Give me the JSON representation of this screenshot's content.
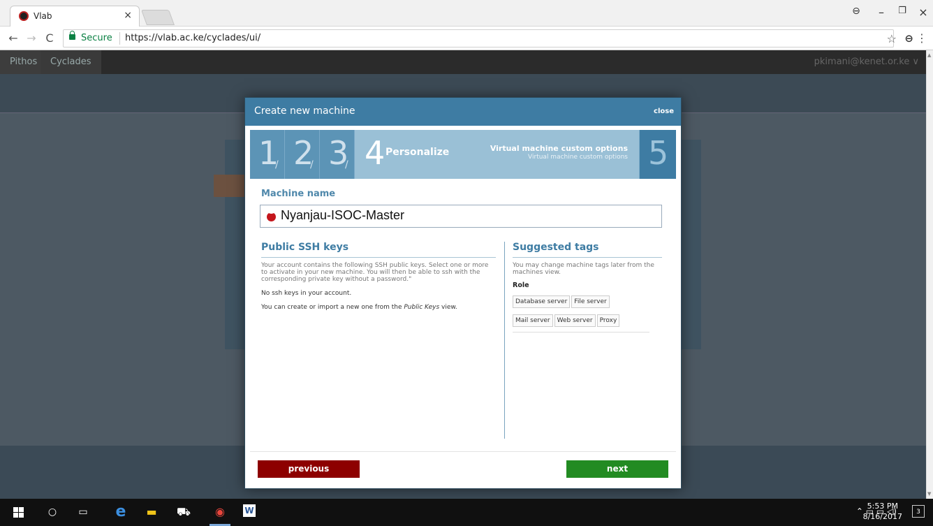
{
  "browser": {
    "tab_title": "Vlab",
    "tab_close": "×",
    "security_label": "Secure",
    "url": "https://vlab.ac.ke/cyclades/ui/",
    "window_controls": [
      "–",
      "❐",
      "×"
    ]
  },
  "topnav": {
    "items": [
      "Pithos",
      "Cyclades"
    ],
    "user": "pkimani@kenet.or.ke ∨"
  },
  "modal": {
    "title": "Create new machine",
    "close_label": "close",
    "steps": [
      {
        "number": "1"
      },
      {
        "number": "2"
      },
      {
        "number": "3"
      },
      {
        "number": "4",
        "label": "Personalize",
        "current": true
      },
      {
        "number": "5"
      }
    ],
    "step_description_main": "Virtual machine custom options",
    "step_description_sub": "Virtual machine custom options",
    "machine_name_label": "Machine name",
    "machine_name_value": "Nyanjau-ISOC-Master",
    "ssh": {
      "title": "Public SSH keys",
      "description": "Your account contains the following SSH public keys. Select one or more to activate in your new machine. You will then be able to ssh with the corresponding private key without a password.\"",
      "no_keys": "No ssh keys in your account.",
      "create_prefix": "You can create or import a new one from the ",
      "create_link": "Public Keys",
      "create_suffix": " view."
    },
    "tags": {
      "title": "Suggested tags",
      "description": "You may change machine tags later from the machines view.",
      "role_label": "Role",
      "items": [
        "Database server",
        "File server",
        "Mail server",
        "Web server",
        "Proxy"
      ]
    },
    "previous_label": "previous",
    "next_label": "next"
  },
  "taskbar": {
    "time": "5:53 PM",
    "date": "8/16/2017",
    "notification_count": "3"
  }
}
